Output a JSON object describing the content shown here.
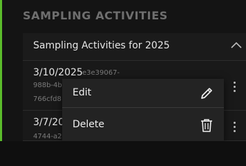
{
  "colors": {
    "accent": "#5bbd2b",
    "background": "#141414",
    "panel": "#191919",
    "menu": "#232323",
    "text": "#e6e6e6",
    "muted_text": "#7b7b7b",
    "section_title": "#6f6f6f"
  },
  "section": {
    "title": "SAMPLING ACTIVITIES"
  },
  "panel": {
    "header_label": "Sampling Activities for 2025",
    "header_icon": "chevron-up-icon"
  },
  "activities": [
    {
      "date": "3/10/2025",
      "id_line1": "e3e39067-",
      "id_line2": "988b-4b",
      "id_line3": "766cfd8",
      "menu_icon": "kebab-menu-icon"
    },
    {
      "date": "3/7/20",
      "id_line2": "4744-a2",
      "menu_icon": "kebab-menu-icon"
    }
  ],
  "context_menu": {
    "edit_label": "Edit",
    "edit_icon": "pencil-icon",
    "delete_label": "Delete",
    "delete_icon": "trash-icon"
  }
}
